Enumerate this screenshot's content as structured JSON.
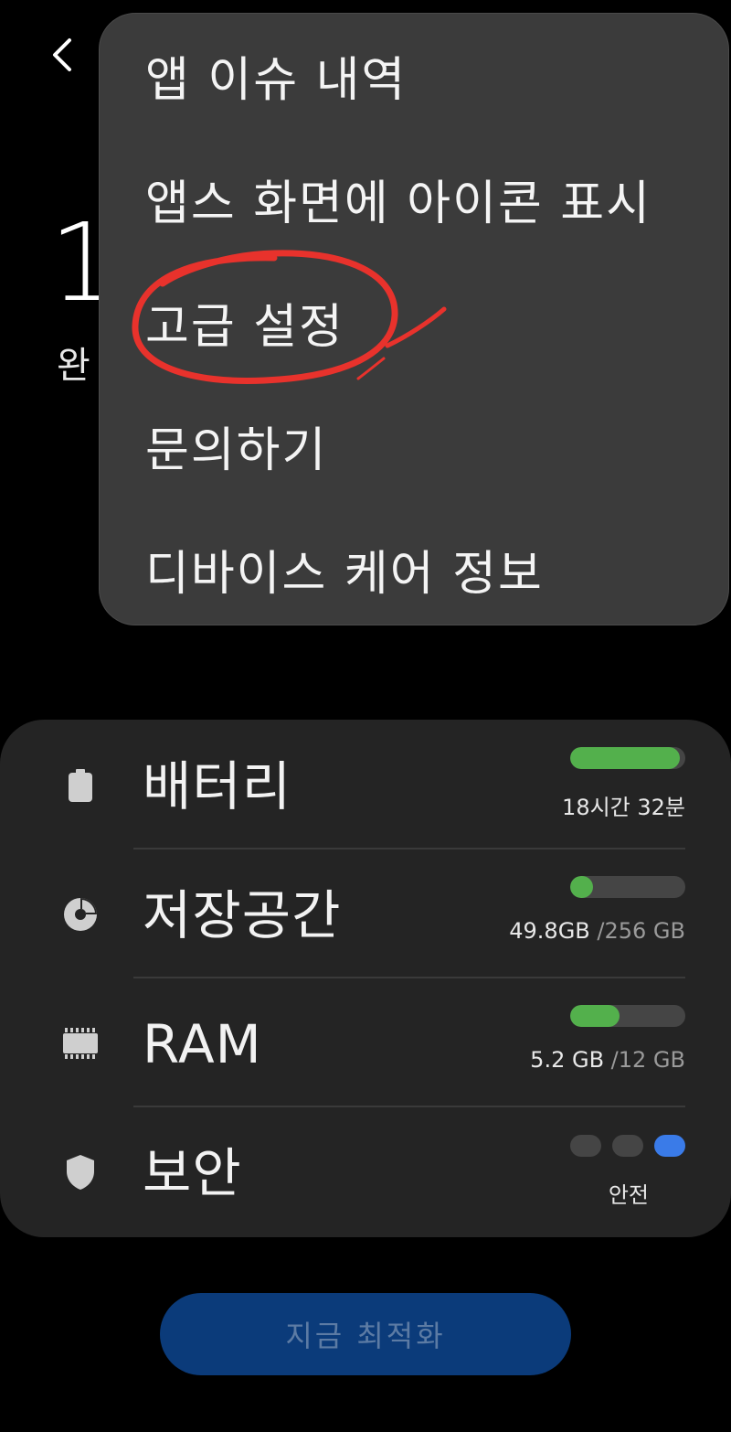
{
  "background": {
    "score_partial": "1",
    "status_partial": "완"
  },
  "menu": {
    "items": [
      {
        "label": "앱 이슈 내역"
      },
      {
        "label": "앱스 화면에 아이콘 표시"
      },
      {
        "label": "고급 설정"
      },
      {
        "label": "문의하기"
      },
      {
        "label": "디바이스 케어 정보"
      }
    ],
    "highlighted_item": "고급 설정"
  },
  "stats": {
    "battery": {
      "label": "배터리",
      "value": "18시간 32분",
      "level": 0.95,
      "icon": "battery-icon"
    },
    "storage": {
      "label": "저장공간",
      "used": "49.8GB",
      "total": "/256 GB",
      "level": 0.195,
      "icon": "storage-pie-icon"
    },
    "ram": {
      "label": "RAM",
      "used": "5.2 GB",
      "total": "/12 GB",
      "level": 0.43,
      "icon": "ram-chip-icon"
    },
    "security": {
      "label": "보안",
      "status": "안전",
      "icon": "shield-icon"
    }
  },
  "optimize_button": {
    "label": "지금 최적화"
  },
  "colors": {
    "bar_green": "#53b04c",
    "security_active": "#3a7be8",
    "annotation_red": "#e8322c",
    "button_bg": "#0b3b7a"
  }
}
